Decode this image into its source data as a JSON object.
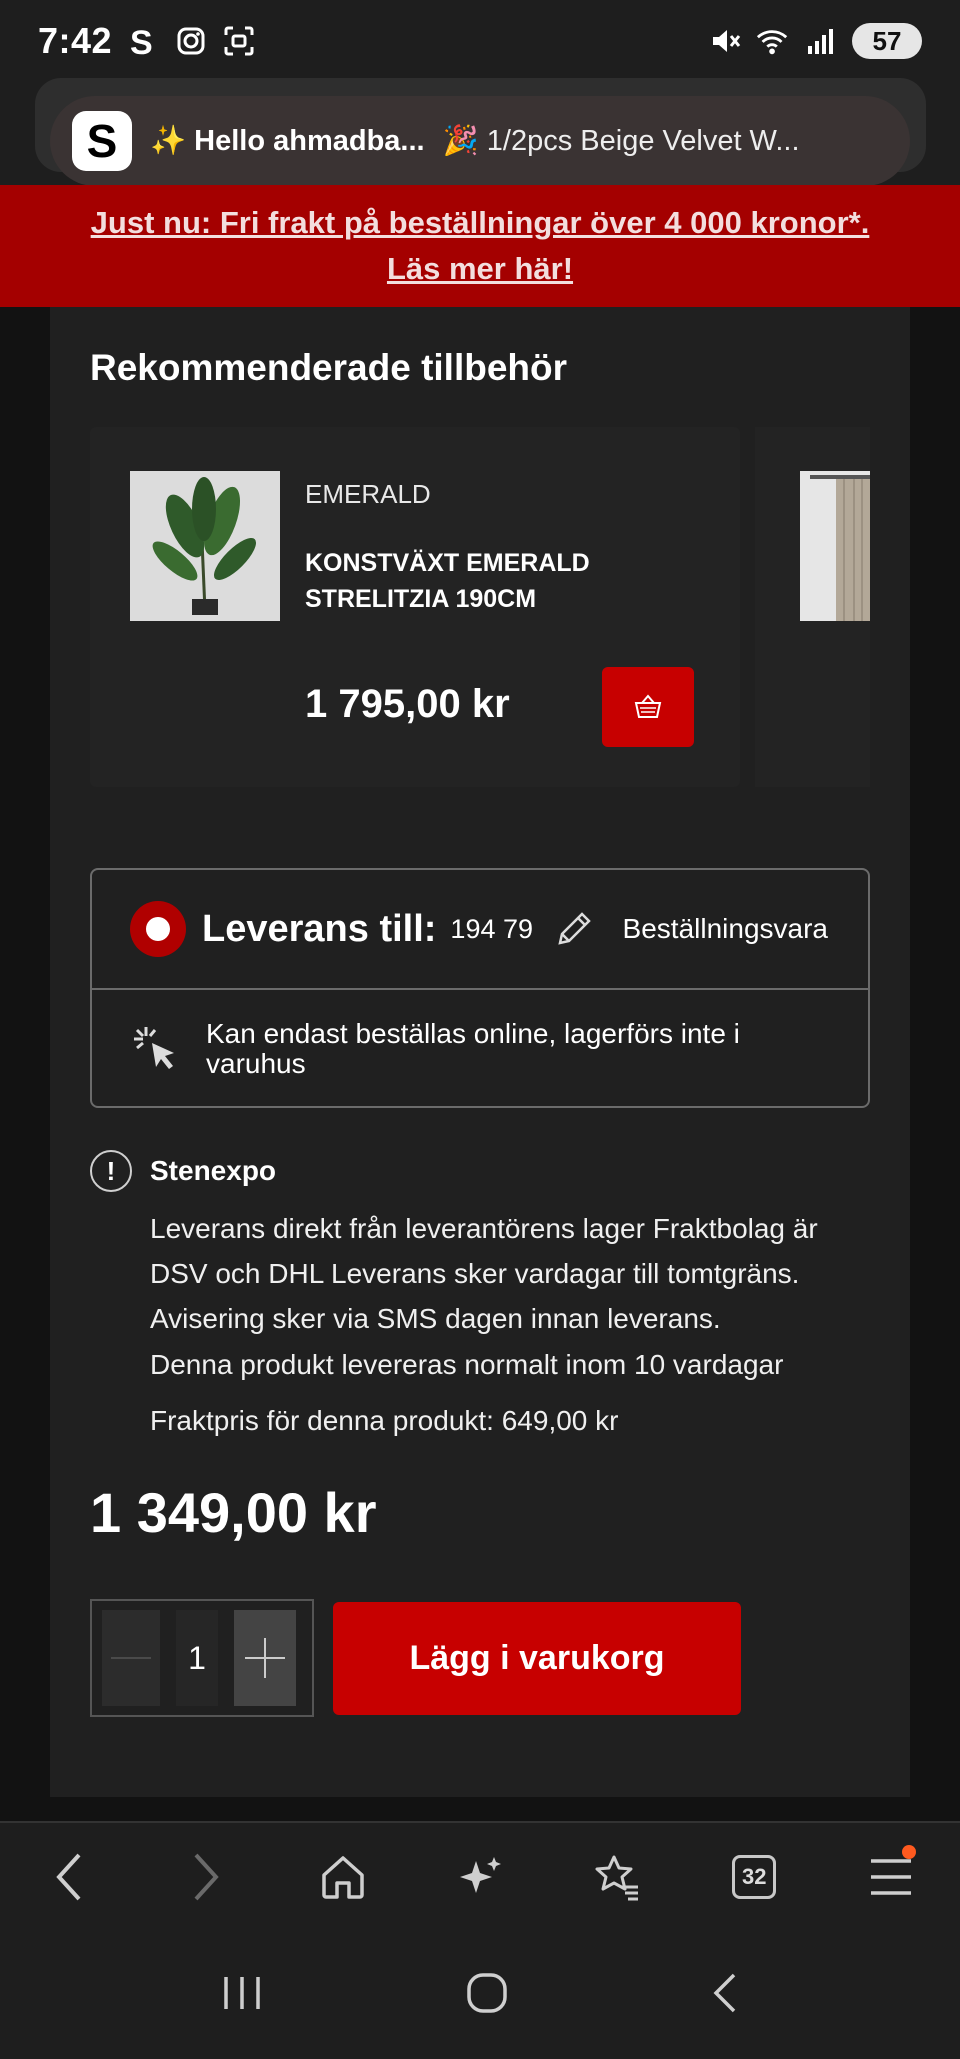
{
  "status_bar": {
    "time": "7:42",
    "battery": "57",
    "icons": [
      "s-app-icon",
      "instagram-icon",
      "screenshot-icon",
      "mute-icon",
      "wifi-icon",
      "signal-icon",
      "battery-icon"
    ]
  },
  "browser": {
    "tab_title_1": "✨ Hello ahmadba...",
    "tab_title_2": "🎉 1/2pcs Beige Velvet W...",
    "tab_count": "32"
  },
  "banner": {
    "line1": "Just nu: Fri frakt på beställningar över 4 000 kronor*.",
    "line2": "Läs mer här!"
  },
  "recommended": {
    "title": "Rekommenderade tillbehör",
    "item": {
      "brand": "EMERALD",
      "name": "KONSTVÄXT EMERALD STRELITZIA 190CM",
      "price": "1 795,00 kr"
    }
  },
  "delivery": {
    "label": "Leverans till:",
    "zip": "194 79",
    "type": "Beställningsvara",
    "online_note": "Kan endast beställas online, lagerförs inte i varuhus"
  },
  "supplier": {
    "name": "Stenexpo",
    "description": "Leverans direkt från leverantörens lager Fraktbolag är DSV och DHL Leverans sker vardagar till tomtgräns. Avisering sker via SMS dagen innan leverans.",
    "lead_time": "Denna produkt levereras normalt inom 10 vardagar",
    "shipping_price": "Fraktpris för denna produkt: 649,00 kr"
  },
  "product": {
    "price": "1 349,00 kr",
    "quantity": "1",
    "add_to_cart": "Lägg i varukorg"
  },
  "colors": {
    "brand_red": "#c70000",
    "banner_red": "#a40000",
    "background": "#202020"
  }
}
